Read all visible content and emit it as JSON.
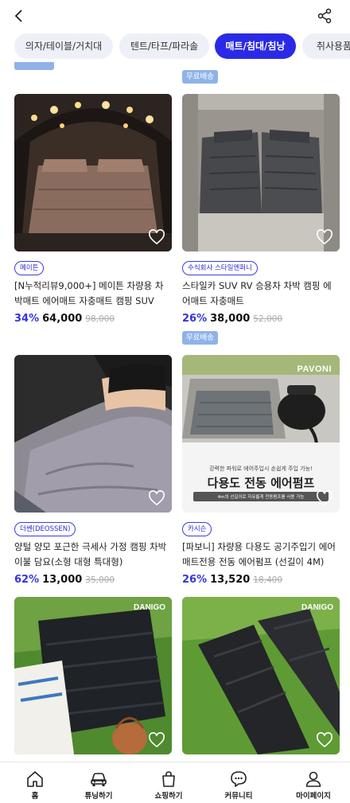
{
  "header": {
    "back_icon": "chevron-left-icon",
    "share_icon": "share-icon"
  },
  "tabs": [
    {
      "label": "의자/테이블/거치대",
      "active": false
    },
    {
      "label": "텐트/타프/파라솔",
      "active": false
    },
    {
      "label": "매트/침대/침낭",
      "active": true
    },
    {
      "label": "취사용품",
      "active": false
    }
  ],
  "products": [
    {
      "badge": "",
      "brand": "메이튼",
      "title": "[N누적리뷰9,000+] 메이튼 차량용 차박매트 에어매트 자충매트 캠핑 SUV",
      "discount": "34%",
      "price": "64,000",
      "original": "98,000"
    },
    {
      "badge": "무료배송",
      "brand": "수식회사 스타일엔퍼니",
      "title": "스타일카 SUV RV 승용차 차박 캠핑 에어매트 자충매트",
      "discount": "26%",
      "price": "38,000",
      "original": "52,000"
    },
    {
      "badge": "",
      "brand": "더쎈(DEOSSEN)",
      "title": "양털 양모 포근한 극세사 가정 캠핑 차박 이불 담요(소형 대형 특대형)",
      "discount": "62%",
      "price": "13,000",
      "original": "35,000"
    },
    {
      "badge": "무료배송",
      "brand": "카시슨",
      "title": "[파보니] 차량용 다용도 공기주입기 에어매트전용 전동 에어펌프 (선길이 4M)",
      "discount": "26%",
      "price": "13,520",
      "original": "18,400"
    },
    {
      "badge": "",
      "brand": "",
      "title": "",
      "discount": "",
      "price": "",
      "original": ""
    },
    {
      "badge": "",
      "brand": "",
      "title": "",
      "discount": "",
      "price": "",
      "original": ""
    }
  ],
  "image_text": {
    "pavoni_logo": "PAVONI",
    "pump_caption": "강력한 파워로 에어주입시 손쉽게 주입 가능!",
    "pump_title": "다용도 전동 에어펌프",
    "pump_sub": "4m의 선길이로 자유롭게 전동펌프를 사용 가능",
    "danigo_logo": "DANIGO"
  },
  "bottom_nav": [
    {
      "label": "홈",
      "icon": "home-icon"
    },
    {
      "label": "튜닝하기",
      "icon": "car-icon"
    },
    {
      "label": "쇼핑하기",
      "icon": "shopping-bag-icon"
    },
    {
      "label": "커뮤니티",
      "icon": "chat-bubble-icon"
    },
    {
      "label": "마이페이지",
      "icon": "user-icon"
    }
  ]
}
